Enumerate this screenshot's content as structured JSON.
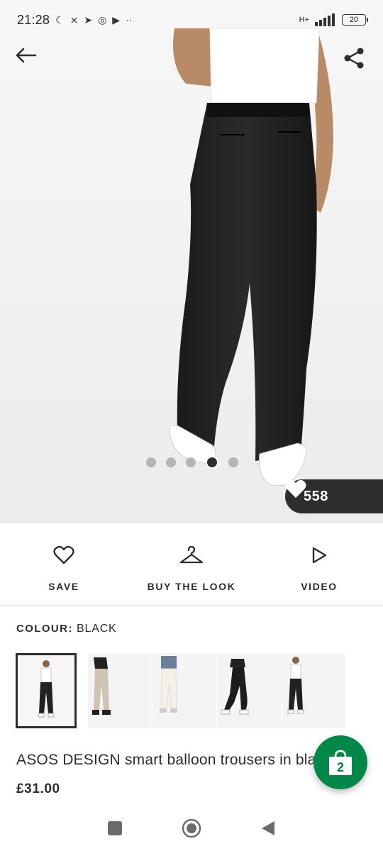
{
  "status_bar": {
    "time": "21:28",
    "network": "H+",
    "battery": "20"
  },
  "product": {
    "likes": "558",
    "image_dots": {
      "count": 5,
      "active": 4
    },
    "actions": [
      {
        "label": "SAVE",
        "icon": "heart-outline-icon"
      },
      {
        "label": "BUY THE LOOK",
        "icon": "hanger-icon"
      },
      {
        "label": "VIDEO",
        "icon": "play-outline-icon"
      }
    ],
    "colour_label": "COLOUR:",
    "colour_value": "BLACK",
    "title": "ASOS DESIGN smart balloon trousers in black",
    "price": "£31.00"
  },
  "bag": {
    "count": "2",
    "color": "#018849"
  },
  "colors": {
    "dark": "#2d2d2d",
    "accent_green": "#018849"
  }
}
